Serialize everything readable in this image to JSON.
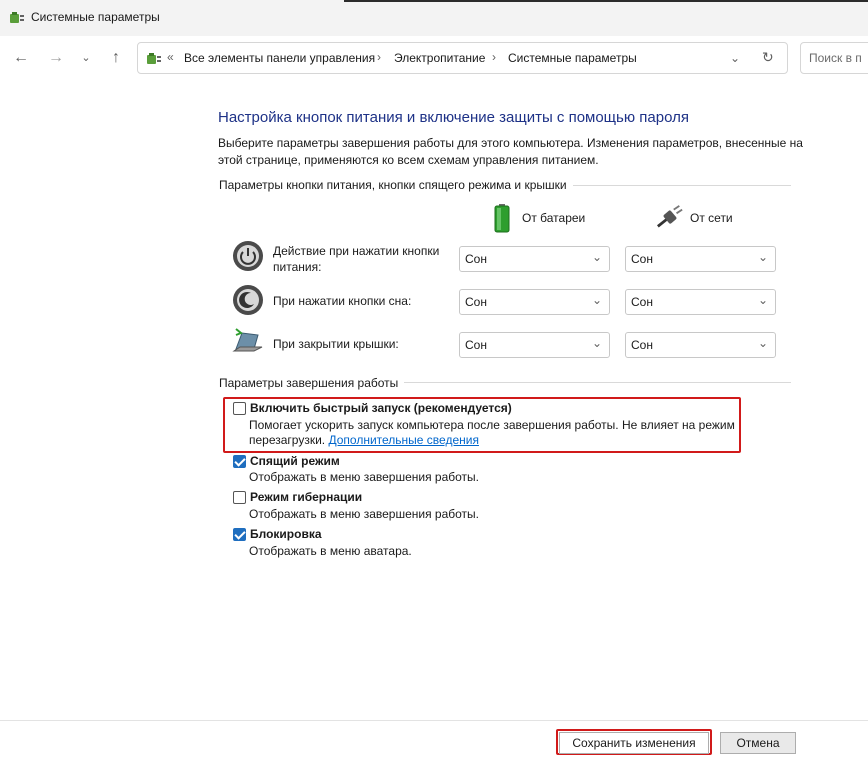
{
  "window": {
    "title": "Системные параметры",
    "icon": "power-options-icon"
  },
  "nav": {
    "breadcrumb_prefix": "«",
    "breadcrumbs": [
      "Все элементы панели управления",
      "Электропитание",
      "Системные параметры"
    ],
    "separator": "›",
    "search_placeholder": "Поиск в п"
  },
  "main": {
    "heading": "Настройка кнопок питания и включение защиты с помощью пароля",
    "description": "Выберите параметры завершения работы для этого компьютера. Изменения параметров, внесенные на этой странице, применяются ко всем схемам управления питанием.",
    "power_section_title": "Параметры кнопки питания, кнопки спящего режима и крышки",
    "col_battery": "От батареи",
    "col_ac": "От сети",
    "rows": [
      {
        "label": "Действие при нажатии кнопки питания:",
        "battery": "Сон",
        "ac": "Сон",
        "icon": "power-button-icon"
      },
      {
        "label": "При нажатии кнопки сна:",
        "battery": "Сон",
        "ac": "Сон",
        "icon": "sleep-button-icon"
      },
      {
        "label": "При закрытии крышки:",
        "battery": "Сон",
        "ac": "Сон",
        "icon": "laptop-lid-icon"
      }
    ],
    "shutdown_section_title": "Параметры завершения работы",
    "options": [
      {
        "label": "Включить быстрый запуск (рекомендуется)",
        "checked": false,
        "sub": "Помогает ускорить запуск компьютера после завершения работы. Не влияет на режим",
        "sub2": "перезагрузки.",
        "link": "Дополнительные сведения"
      },
      {
        "label": "Спящий режим",
        "checked": true,
        "sub": "Отображать в меню завершения работы."
      },
      {
        "label": "Режим гибернации",
        "checked": false,
        "sub": "Отображать в меню завершения работы."
      },
      {
        "label": "Блокировка",
        "checked": true,
        "sub": "Отображать в меню аватара."
      }
    ]
  },
  "footer": {
    "save_label": "Сохранить изменения",
    "cancel_label": "Отмена"
  },
  "colors": {
    "heading": "#1e3287",
    "highlight": "#d11a1a",
    "checkbox": "#1f6ebf",
    "link": "#0066cc"
  }
}
